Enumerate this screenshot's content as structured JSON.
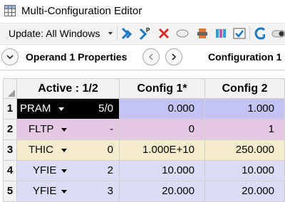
{
  "window": {
    "title": "Multi-Configuration Editor"
  },
  "toolbar": {
    "update_label": "Update: All Windows"
  },
  "header": {
    "operand_label": "Operand  1 Properties",
    "config_label": "Configuration 1"
  },
  "grid": {
    "columns": [
      "Active : 1/2",
      "Config 1*",
      "Config 2"
    ],
    "rows": [
      {
        "num": "1",
        "operand": "PRAM",
        "param": "5/0",
        "config1": "0.000",
        "config2": "1.000",
        "color": "#c4c4f4"
      },
      {
        "num": "2",
        "operand": "FLTP",
        "param": "-",
        "config1": "0",
        "config2": "1",
        "color": "#e4c8e4"
      },
      {
        "num": "3",
        "operand": "THIC",
        "param": "0",
        "config1": "1.000E+10",
        "config2": "250.000",
        "color": "#f4eccc"
      },
      {
        "num": "4",
        "operand": "YFIE",
        "param": "2",
        "config1": "10.000",
        "config2": "10.000",
        "color": "#dcdcf4"
      },
      {
        "num": "5",
        "operand": "YFIE",
        "param": "3",
        "config1": "20.000",
        "config2": "20.000",
        "color": "#dcdcf4"
      }
    ]
  },
  "colors": {
    "selected_cell": "#000000",
    "selected_text": "#ffffff",
    "accent_blue": "#1a78c2",
    "accent_red": "#d42b2b"
  }
}
